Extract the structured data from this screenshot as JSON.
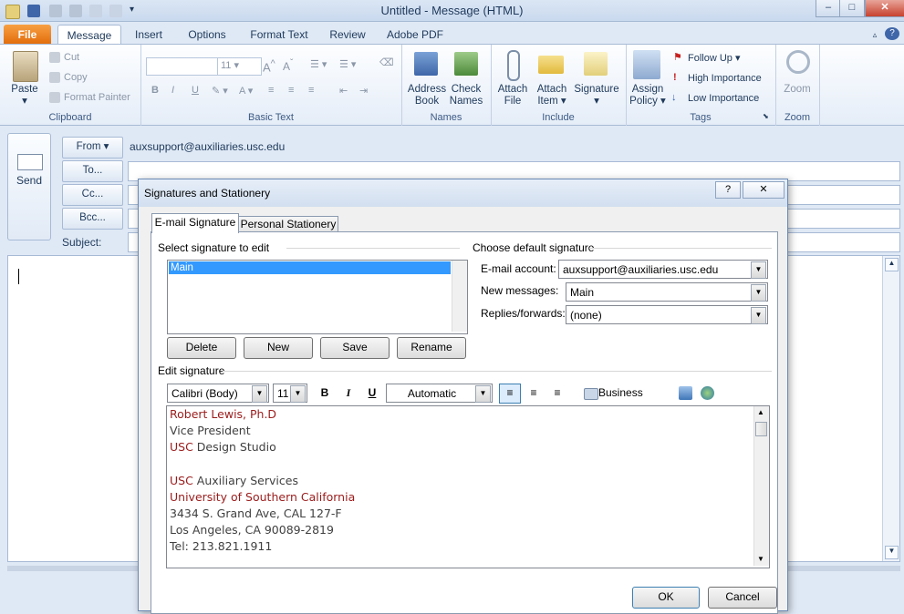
{
  "window": {
    "title": "Untitled - Message (HTML)"
  },
  "ribbon_tabs": [
    "File",
    "Message",
    "Insert",
    "Options",
    "Format Text",
    "Review",
    "Adobe PDF"
  ],
  "clipboard": {
    "paste": "Paste",
    "cut": "Cut",
    "copy": "Copy",
    "format_painter": "Format Painter",
    "group": "Clipboard"
  },
  "basic_text": {
    "font_size": "11",
    "group": "Basic Text"
  },
  "names": {
    "address_book_1": "Address",
    "address_book_2": "Book",
    "check_names_1": "Check",
    "check_names_2": "Names",
    "group": "Names"
  },
  "include": {
    "attach_file_1": "Attach",
    "attach_file_2": "File",
    "attach_item_1": "Attach",
    "attach_item_2": "Item",
    "signature": "Signature",
    "group": "Include"
  },
  "tags": {
    "assign_policy_1": "Assign",
    "assign_policy_2": "Policy",
    "follow_up": "Follow Up",
    "high_importance": "High Importance",
    "low_importance": "Low Importance",
    "group": "Tags"
  },
  "zoom": {
    "label": "Zoom",
    "group": "Zoom"
  },
  "message": {
    "send": "Send",
    "from_button": "From",
    "from_value": "auxsupport@auxiliaries.usc.edu",
    "to_button": "To...",
    "cc_button": "Cc...",
    "bcc_button": "Bcc...",
    "subject_label": "Subject:"
  },
  "dialog": {
    "title": "Signatures and Stationery",
    "help": "?",
    "tabs": [
      "E-mail Signature",
      "Personal Stationery"
    ],
    "select_label": "Select signature to edit",
    "signatures": [
      "Main"
    ],
    "buttons": {
      "delete": "Delete",
      "new": "New",
      "save": "Save",
      "rename": "Rename",
      "ok": "OK",
      "cancel": "Cancel"
    },
    "default_label": "Choose default signature",
    "email_account_label": "E-mail account:",
    "email_account_value": "auxsupport@auxiliaries.usc.edu",
    "new_messages_label": "New messages:",
    "new_messages_value": "Main",
    "replies_label": "Replies/forwards:",
    "replies_value": "(none)",
    "edit_label": "Edit signature",
    "font": "Calibri (Body)",
    "size": "11",
    "bold": "B",
    "italic": "I",
    "underline": "U",
    "color": "Automatic",
    "business_card": "Business Card",
    "signature_lines": {
      "l1": "Robert Lewis, Ph.D",
      "l2": "Vice President",
      "l3_a": "USC",
      "l3_b": " Design Studio",
      "l5_a": "USC",
      "l5_b": " Auxiliary Services",
      "l6": "University of Southern California",
      "l7": "3434 S. Grand Ave, CAL 127-F",
      "l8": "Los Angeles, CA 90089-2819",
      "l9": "Tel: 213.821.1911"
    }
  }
}
